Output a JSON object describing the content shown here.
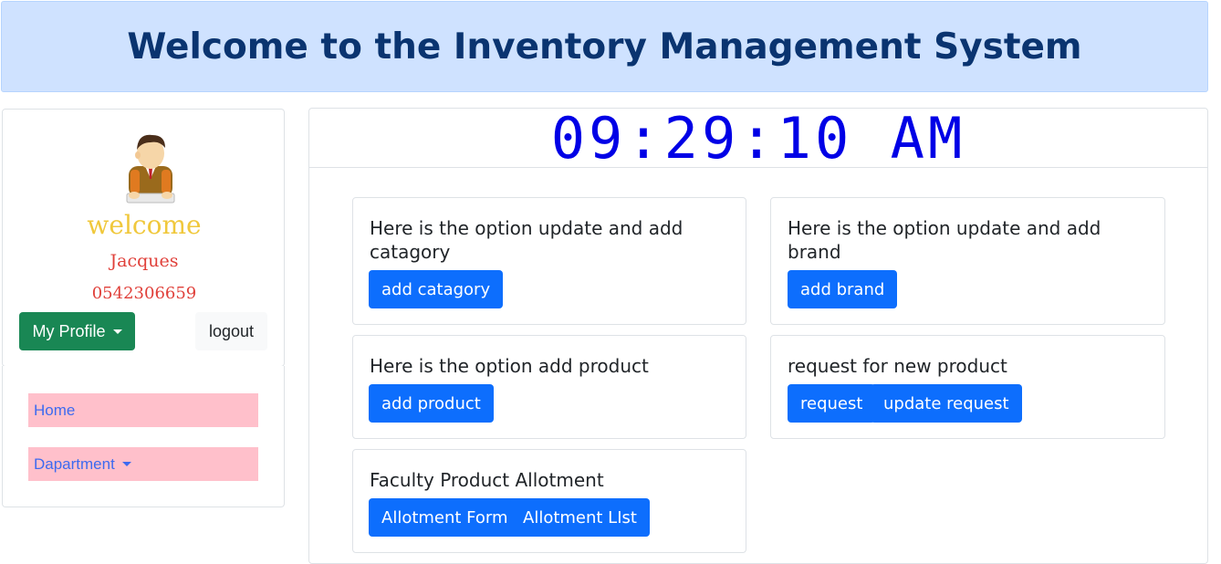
{
  "header": {
    "title": "Welcome to the Inventory Management System"
  },
  "profile": {
    "avatar_icon": "user-avatar-icon",
    "welcome": "welcome",
    "name": "Jacques",
    "phone": "0542306659",
    "my_profile_label": "My Profile",
    "logout_label": "logout"
  },
  "nav": {
    "items": [
      {
        "label": "Home"
      },
      {
        "label": "Dapartment"
      }
    ]
  },
  "clock": {
    "time": "09:29:10 AM"
  },
  "options": [
    {
      "title": "Here is the option update and add catagory",
      "buttons": [
        "add catagory"
      ]
    },
    {
      "title": "Here is the option update and add brand",
      "buttons": [
        "add brand"
      ]
    },
    {
      "title": "Here is the option add product",
      "buttons": [
        "add product"
      ]
    },
    {
      "title": "request for new product",
      "buttons": [
        "request",
        "update request"
      ]
    },
    {
      "title": "Faculty Product Allotment",
      "buttons": [
        "Allotment Form",
        "Allotment LIst"
      ]
    }
  ],
  "colors": {
    "banner_bg": "#cfe2ff",
    "banner_text": "#0a3470",
    "primary": "#0d6efd",
    "success": "#198754",
    "nav_bg": "#ffc0cb",
    "clock": "#0000e6",
    "welcome": "#f0c83c",
    "user_text": "#e0403a"
  }
}
